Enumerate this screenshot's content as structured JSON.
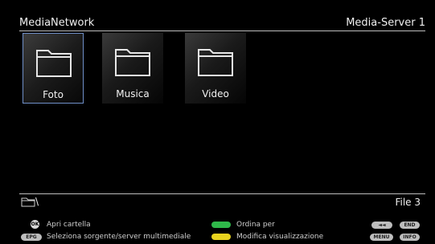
{
  "header": {
    "title": "MediaNetwork",
    "server": "Media-Server 1"
  },
  "folders": [
    {
      "label": "Foto",
      "selected": true
    },
    {
      "label": "Musica",
      "selected": false
    },
    {
      "label": "Video",
      "selected": false
    }
  ],
  "footer": {
    "path": "\\",
    "count": "File 3",
    "hints": {
      "ok_key": "OK",
      "ok_label": "Apri cartella",
      "epg_key": "EPG",
      "epg_label": "Seleziona sorgente/server multimediale",
      "green_label": "Ordina per",
      "yellow_label": "Modifica visualizzazione",
      "rewind_key": "◄◄",
      "end_key": "END",
      "menu_key": "MENU",
      "info_key": "INFO"
    }
  },
  "colors": {
    "selection": "#6f8fc8",
    "green": "#2fb84a",
    "yellow": "#e8d21e"
  },
  "icons": [
    "folder-icon",
    "folder-outline-icon",
    "ok-button-icon"
  ]
}
